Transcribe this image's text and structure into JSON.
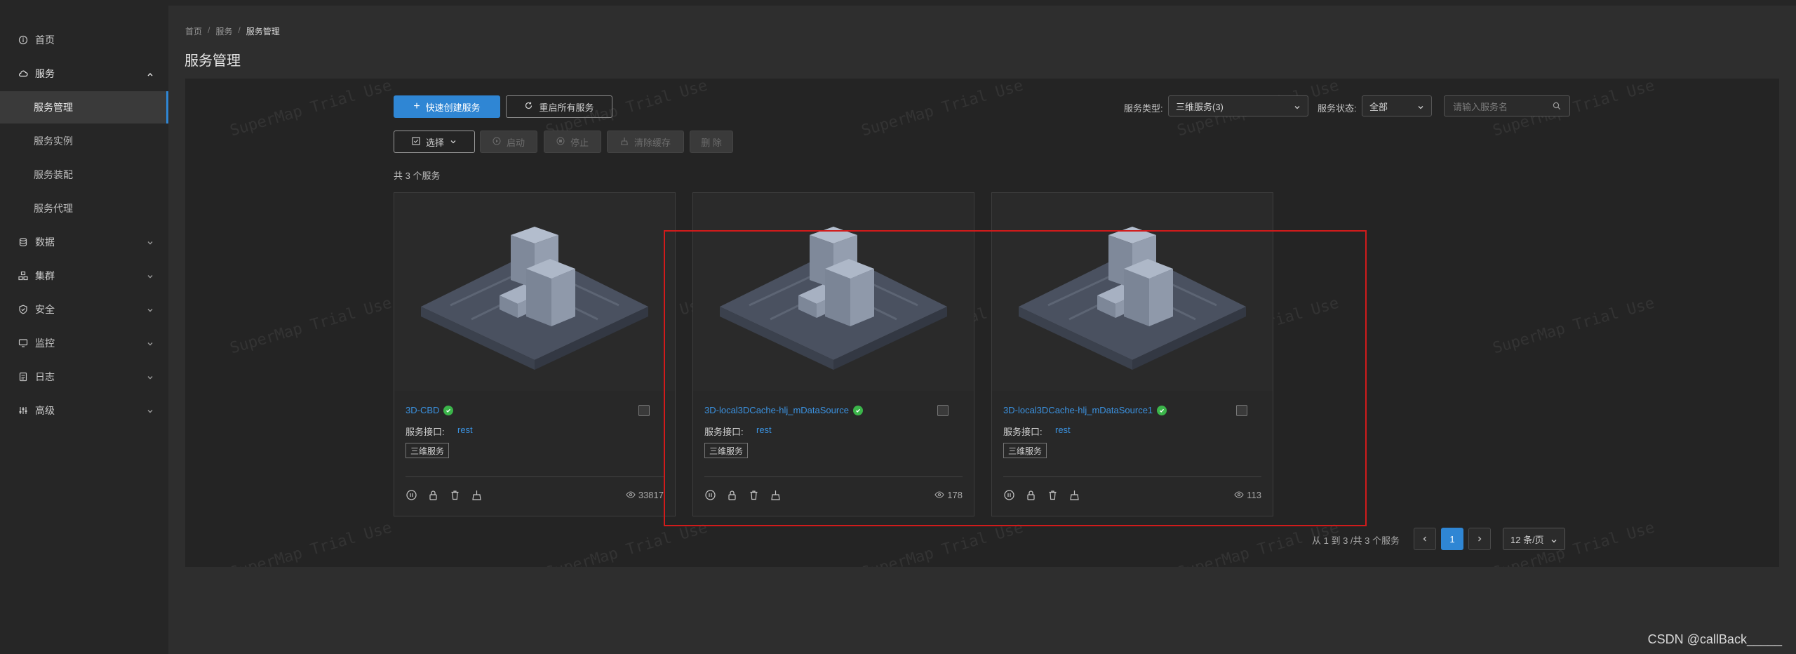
{
  "sidebar": {
    "items": [
      {
        "label": "首页",
        "icon": "info-icon"
      },
      {
        "label": "服务",
        "icon": "cloud-icon"
      },
      {
        "label": "数据",
        "icon": "database-icon"
      },
      {
        "label": "集群",
        "icon": "cluster-icon"
      },
      {
        "label": "安全",
        "icon": "shield-icon"
      },
      {
        "label": "监控",
        "icon": "monitor-icon"
      },
      {
        "label": "日志",
        "icon": "log-icon"
      },
      {
        "label": "高级",
        "icon": "sliders-icon"
      }
    ],
    "service_sub": [
      "服务管理",
      "服务实例",
      "服务装配",
      "服务代理"
    ]
  },
  "breadcrumb": [
    "首页",
    "服务",
    "服务管理"
  ],
  "page_title": "服务管理",
  "toolbar": {
    "create": "快速创建服务",
    "restart_all": "重启所有服务",
    "select": "选择",
    "start": "启动",
    "stop": "停止",
    "clear_cache": "清除缓存",
    "delete": "删 除",
    "type_label": "服务类型:",
    "type_value": "三维服务(3)",
    "status_label": "服务状态:",
    "status_value": "全部",
    "search_placeholder": "请输入服务名"
  },
  "total_text": "共 3 个服务",
  "cards": [
    {
      "name": "3D-CBD",
      "iface_label": "服务接口:",
      "iface": "rest",
      "tag": "三维服务",
      "views": "33817"
    },
    {
      "name": "3D-local3DCache-hlj_mDataSource",
      "iface_label": "服务接口:",
      "iface": "rest",
      "tag": "三维服务",
      "views": "178"
    },
    {
      "name": "3D-local3DCache-hlj_mDataSource1",
      "iface_label": "服务接口:",
      "iface": "rest",
      "tag": "三维服务",
      "views": "113"
    }
  ],
  "pagination": {
    "summary": "从 1 到 3 /共 3 个服务",
    "current": "1",
    "page_size": "12 条/页"
  },
  "watermark": "SuperMap Trial Use",
  "credit": "CSDN @callBack_____",
  "colors": {
    "accent": "#2f86d4",
    "ok": "#3bb54a",
    "highlight": "#d11b1b"
  }
}
